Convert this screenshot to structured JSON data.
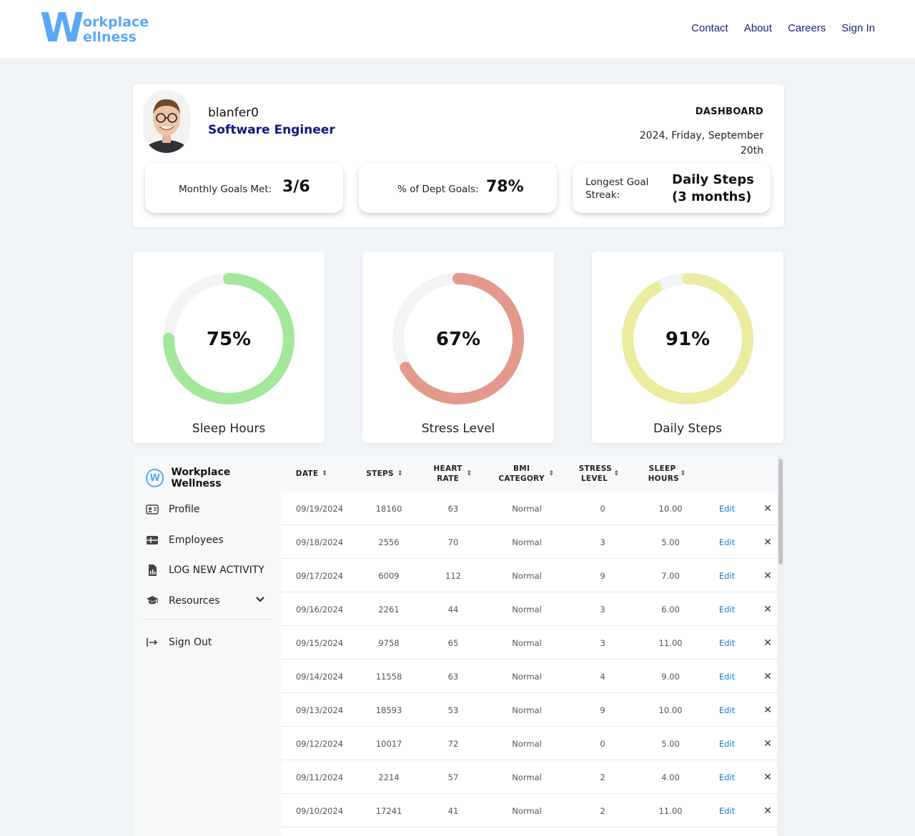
{
  "brand": {
    "logo_w": "W",
    "logo_line1": "orkplace",
    "logo_line2": "ellness"
  },
  "nav": {
    "links": [
      "Contact",
      "About",
      "Careers",
      "Sign In"
    ]
  },
  "profile": {
    "username": "blanfer0",
    "job_title": "Software Engineer",
    "dashboard_label": "DASHBOARD",
    "date": "2024, Friday, September 20th"
  },
  "stats": [
    {
      "label": "Monthly Goals Met:",
      "value": "3/6"
    },
    {
      "label": "% of Dept Goals:",
      "value": "78%"
    },
    {
      "label": "Longest Goal Streak:",
      "value": "Daily Steps (3 months)"
    }
  ],
  "gauges": [
    {
      "label": "Sleep Hours",
      "percent_text": "75%",
      "percent": 75,
      "color": "#a3e89a"
    },
    {
      "label": "Stress Level",
      "percent_text": "67%",
      "percent": 67,
      "color": "#e39a8c"
    },
    {
      "label": "Daily Steps",
      "percent_text": "91%",
      "percent": 91,
      "color": "#ebeca0"
    }
  ],
  "sidebar": {
    "brand": "Workplace Wellness",
    "items": [
      "Profile",
      "Employees",
      "LOG NEW ACTIVITY",
      "Resources",
      "Sign Out"
    ]
  },
  "table": {
    "headers": [
      "DATE",
      "STEPS",
      "HEART RATE",
      "BMI CATEGORY",
      "STRESS LEVEL",
      "SLEEP HOURS"
    ],
    "edit_label": "Edit",
    "delete_label": "✕",
    "rows": [
      [
        "09/19/2024",
        "18160",
        "63",
        "Normal",
        "0",
        "10.00"
      ],
      [
        "09/18/2024",
        "2556",
        "70",
        "Normal",
        "3",
        "5.00"
      ],
      [
        "09/17/2024",
        "6009",
        "112",
        "Normal",
        "9",
        "7.00"
      ],
      [
        "09/16/2024",
        "2261",
        "44",
        "Normal",
        "3",
        "6.00"
      ],
      [
        "09/15/2024",
        "9758",
        "65",
        "Normal",
        "3",
        "11.00"
      ],
      [
        "09/14/2024",
        "11558",
        "63",
        "Normal",
        "4",
        "9.00"
      ],
      [
        "09/13/2024",
        "18593",
        "53",
        "Normal",
        "9",
        "10.00"
      ],
      [
        "09/12/2024",
        "10017",
        "72",
        "Normal",
        "0",
        "5.00"
      ],
      [
        "09/11/2024",
        "2214",
        "57",
        "Normal",
        "2",
        "4.00"
      ],
      [
        "09/10/2024",
        "17241",
        "41",
        "Normal",
        "2",
        "11.00"
      ]
    ]
  }
}
